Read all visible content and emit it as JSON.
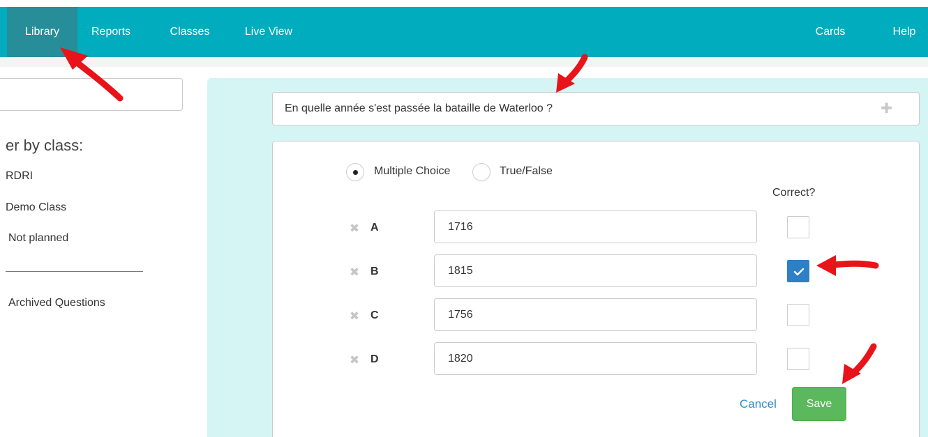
{
  "nav": {
    "items": [
      {
        "label": "Library",
        "active": true
      },
      {
        "label": "Reports"
      },
      {
        "label": "Classes"
      },
      {
        "label": "Live View"
      }
    ],
    "right_items": [
      {
        "label": "Cards"
      },
      {
        "label": "Help"
      }
    ]
  },
  "sidebar": {
    "filter_title": "er by class:",
    "items": [
      "RDRI",
      "Demo Class",
      "Not planned"
    ],
    "archived": "Archived Questions"
  },
  "question": {
    "text": "En quelle année s'est passée la bataille de Waterloo ?"
  },
  "question_type": {
    "options": [
      {
        "label": "Multiple Choice",
        "selected": true
      },
      {
        "label": "True/False",
        "selected": false
      }
    ]
  },
  "answers": {
    "correct_header": "Correct?",
    "rows": [
      {
        "letter": "A",
        "value": "1716",
        "correct": false
      },
      {
        "letter": "B",
        "value": "1815",
        "correct": true
      },
      {
        "letter": "C",
        "value": "1756",
        "correct": false
      },
      {
        "letter": "D",
        "value": "1820",
        "correct": false
      }
    ]
  },
  "actions": {
    "cancel_label": "Cancel",
    "save_label": "Save"
  },
  "colors": {
    "nav_bg": "#00acbd",
    "nav_active": "#278e99",
    "panel_bg": "#d5f4f4",
    "checkbox_checked": "#2d7fc6",
    "save_green": "#5cb85c",
    "annotation_arrow": "#e8141a"
  }
}
